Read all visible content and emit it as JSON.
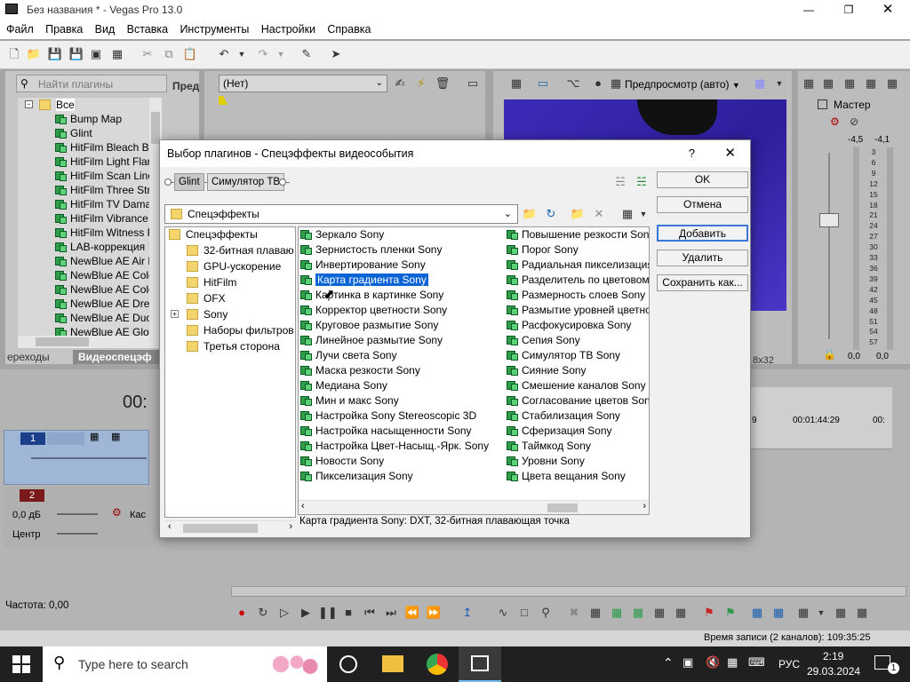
{
  "window": {
    "title": "Без названия * - Vegas Pro 13.0"
  },
  "menu": [
    "Файл",
    "Правка",
    "Вид",
    "Вставка",
    "Инструменты",
    "Настройки",
    "Справка"
  ],
  "plugins_pane": {
    "search_placeholder": "Найти плагины",
    "side_label": "Пред",
    "root": "Все",
    "items": [
      "Bump Map",
      "Glint",
      "HitFilm Bleach Byp",
      "HitFilm Light Flare",
      "HitFilm Scan Lines",
      "HitFilm Three Strip",
      "HitFilm TV Damage",
      "HitFilm Vibrance",
      "HitFilm Witness Pr",
      "LAB-коррекция",
      "NewBlue AE Air Br",
      "NewBlue AE Color",
      "NewBlue AE Color",
      "NewBlue AE Drear",
      "NewBlue AE DuoC",
      "NewBlue AE Glow"
    ],
    "tabs": [
      "ереходы",
      "Видеоспецэф"
    ]
  },
  "mid_pane": {
    "preset": "(Нет)"
  },
  "preview": {
    "mode": "Предпросмотр (авто)",
    "size_label": "8x32"
  },
  "master": {
    "label": "Мастер",
    "levels": [
      "-4,5",
      "-4,1"
    ],
    "scale": [
      "3",
      "6",
      "9",
      "12",
      "15",
      "18",
      "21",
      "24",
      "27",
      "30",
      "33",
      "36",
      "39",
      "42",
      "45",
      "48",
      "51",
      "54",
      "57"
    ],
    "values": [
      "0,0",
      "0,0"
    ]
  },
  "timeline": {
    "time": "00:",
    "ruler": [
      "9",
      "00:01:44:29",
      "00:"
    ],
    "track1": {
      "num": "1"
    },
    "track2": {
      "num": "2",
      "volume": "0,0 дБ",
      "pan": "Центр",
      "mode": "Кас"
    },
    "rate": "Частота: 0,00"
  },
  "status": {
    "record_time": "Время записи (2 каналов): 109:35:25"
  },
  "dialog": {
    "title": "Выбор плагинов - Спецэффекты видеособытия",
    "help": "?",
    "close": "✕",
    "chain": [
      "Glint",
      "Симулятор ТВ"
    ],
    "folder": "Спецэффекты",
    "buttons": {
      "ok": "OK",
      "cancel": "Отмена",
      "add": "Добавить",
      "remove": "Удалить",
      "save_as": "Сохранить как..."
    },
    "tree": {
      "root": "Спецэффекты",
      "children": [
        "32-битная плаваю",
        "GPU-ускорение",
        "HitFilm",
        "OFX",
        "Sony",
        "Наборы фильтров",
        "Третья сторона"
      ]
    },
    "list_col1": [
      "Зеркало Sony",
      "Зернистость пленки Sony",
      "Инвертирование Sony",
      "Карта градиента Sony",
      "Картинка в картинке Sony",
      "Корректор цветности Sony",
      "Круговое размытие Sony",
      "Линейное размытие Sony",
      "Лучи света Sony",
      "Маска резкости Sony",
      "Медиана Sony",
      "Мин и макс Sony",
      "Настройка Sony Stereoscopic 3D",
      "Настройка насыщенности Sony",
      "Настройка Цвет-Насыщ.-Ярк. Sony",
      "Новости Sony",
      "Пикселизация Sony"
    ],
    "list_col2": [
      "Повышение резкости Sony",
      "Порог Sony",
      "Радиальная пикселизация",
      "Разделитель по цветовому",
      "Размерность слоев Sony",
      "Размытие уровней цветно",
      "Расфокусировка Sony",
      "Сепия Sony",
      "Симулятор ТВ Sony",
      "Сияние Sony",
      "Смешение каналов Sony",
      "Согласование цветов Sony",
      "Стабилизация Sony",
      "Сферизация Sony",
      "Таймкод Sony",
      "Уровни Sony",
      "Цвета вещания Sony"
    ],
    "selected": "Карта градиента Sony",
    "description": "Карта градиента Sony: DXT, 32-битная плавающая точка"
  },
  "taskbar": {
    "search_placeholder": "Type here to search",
    "lang": "РУС",
    "time": "2:19",
    "date": "29.03.2024",
    "notif": "1"
  }
}
